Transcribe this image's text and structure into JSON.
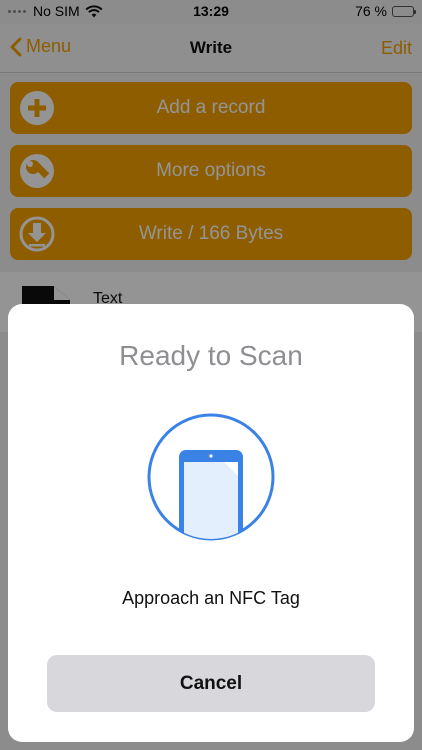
{
  "status_bar": {
    "carrier": "No SIM",
    "time": "13:29",
    "battery": "76 %",
    "battery_level": 0.76
  },
  "nav": {
    "back_label": "Menu",
    "title": "Write",
    "edit_label": "Edit"
  },
  "actions": [
    {
      "label": "Add a record",
      "icon": "plus-circle-icon"
    },
    {
      "label": "More options",
      "icon": "wrench-icon"
    },
    {
      "label": "Write / 166 Bytes",
      "icon": "download-icon"
    }
  ],
  "record": {
    "label": "Text",
    "icon": "document-icon"
  },
  "sheet": {
    "title": "Ready to Scan",
    "message": "Approach an NFC Tag",
    "cancel_label": "Cancel",
    "icon": "phone-icon"
  },
  "colors": {
    "accent": "#f5a100",
    "nfc_blue": "#3b82e6",
    "overlay": "rgba(0,0,0,0.42)"
  }
}
